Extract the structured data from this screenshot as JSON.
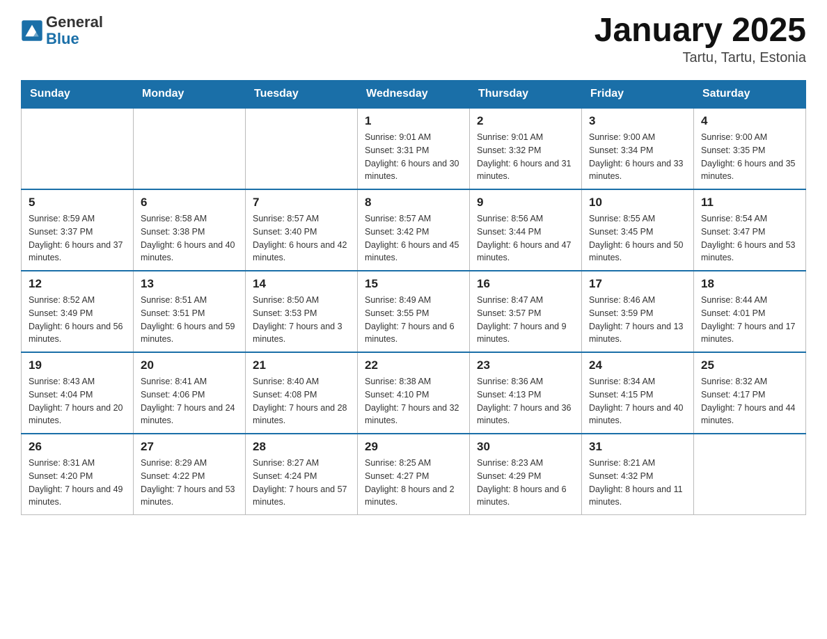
{
  "header": {
    "logo_general": "General",
    "logo_blue": "Blue",
    "month_title": "January 2025",
    "location": "Tartu, Tartu, Estonia"
  },
  "days_of_week": [
    "Sunday",
    "Monday",
    "Tuesday",
    "Wednesday",
    "Thursday",
    "Friday",
    "Saturday"
  ],
  "weeks": [
    [
      {
        "day": "",
        "info": ""
      },
      {
        "day": "",
        "info": ""
      },
      {
        "day": "",
        "info": ""
      },
      {
        "day": "1",
        "info": "Sunrise: 9:01 AM\nSunset: 3:31 PM\nDaylight: 6 hours\nand 30 minutes."
      },
      {
        "day": "2",
        "info": "Sunrise: 9:01 AM\nSunset: 3:32 PM\nDaylight: 6 hours\nand 31 minutes."
      },
      {
        "day": "3",
        "info": "Sunrise: 9:00 AM\nSunset: 3:34 PM\nDaylight: 6 hours\nand 33 minutes."
      },
      {
        "day": "4",
        "info": "Sunrise: 9:00 AM\nSunset: 3:35 PM\nDaylight: 6 hours\nand 35 minutes."
      }
    ],
    [
      {
        "day": "5",
        "info": "Sunrise: 8:59 AM\nSunset: 3:37 PM\nDaylight: 6 hours\nand 37 minutes."
      },
      {
        "day": "6",
        "info": "Sunrise: 8:58 AM\nSunset: 3:38 PM\nDaylight: 6 hours\nand 40 minutes."
      },
      {
        "day": "7",
        "info": "Sunrise: 8:57 AM\nSunset: 3:40 PM\nDaylight: 6 hours\nand 42 minutes."
      },
      {
        "day": "8",
        "info": "Sunrise: 8:57 AM\nSunset: 3:42 PM\nDaylight: 6 hours\nand 45 minutes."
      },
      {
        "day": "9",
        "info": "Sunrise: 8:56 AM\nSunset: 3:44 PM\nDaylight: 6 hours\nand 47 minutes."
      },
      {
        "day": "10",
        "info": "Sunrise: 8:55 AM\nSunset: 3:45 PM\nDaylight: 6 hours\nand 50 minutes."
      },
      {
        "day": "11",
        "info": "Sunrise: 8:54 AM\nSunset: 3:47 PM\nDaylight: 6 hours\nand 53 minutes."
      }
    ],
    [
      {
        "day": "12",
        "info": "Sunrise: 8:52 AM\nSunset: 3:49 PM\nDaylight: 6 hours\nand 56 minutes."
      },
      {
        "day": "13",
        "info": "Sunrise: 8:51 AM\nSunset: 3:51 PM\nDaylight: 6 hours\nand 59 minutes."
      },
      {
        "day": "14",
        "info": "Sunrise: 8:50 AM\nSunset: 3:53 PM\nDaylight: 7 hours\nand 3 minutes."
      },
      {
        "day": "15",
        "info": "Sunrise: 8:49 AM\nSunset: 3:55 PM\nDaylight: 7 hours\nand 6 minutes."
      },
      {
        "day": "16",
        "info": "Sunrise: 8:47 AM\nSunset: 3:57 PM\nDaylight: 7 hours\nand 9 minutes."
      },
      {
        "day": "17",
        "info": "Sunrise: 8:46 AM\nSunset: 3:59 PM\nDaylight: 7 hours\nand 13 minutes."
      },
      {
        "day": "18",
        "info": "Sunrise: 8:44 AM\nSunset: 4:01 PM\nDaylight: 7 hours\nand 17 minutes."
      }
    ],
    [
      {
        "day": "19",
        "info": "Sunrise: 8:43 AM\nSunset: 4:04 PM\nDaylight: 7 hours\nand 20 minutes."
      },
      {
        "day": "20",
        "info": "Sunrise: 8:41 AM\nSunset: 4:06 PM\nDaylight: 7 hours\nand 24 minutes."
      },
      {
        "day": "21",
        "info": "Sunrise: 8:40 AM\nSunset: 4:08 PM\nDaylight: 7 hours\nand 28 minutes."
      },
      {
        "day": "22",
        "info": "Sunrise: 8:38 AM\nSunset: 4:10 PM\nDaylight: 7 hours\nand 32 minutes."
      },
      {
        "day": "23",
        "info": "Sunrise: 8:36 AM\nSunset: 4:13 PM\nDaylight: 7 hours\nand 36 minutes."
      },
      {
        "day": "24",
        "info": "Sunrise: 8:34 AM\nSunset: 4:15 PM\nDaylight: 7 hours\nand 40 minutes."
      },
      {
        "day": "25",
        "info": "Sunrise: 8:32 AM\nSunset: 4:17 PM\nDaylight: 7 hours\nand 44 minutes."
      }
    ],
    [
      {
        "day": "26",
        "info": "Sunrise: 8:31 AM\nSunset: 4:20 PM\nDaylight: 7 hours\nand 49 minutes."
      },
      {
        "day": "27",
        "info": "Sunrise: 8:29 AM\nSunset: 4:22 PM\nDaylight: 7 hours\nand 53 minutes."
      },
      {
        "day": "28",
        "info": "Sunrise: 8:27 AM\nSunset: 4:24 PM\nDaylight: 7 hours\nand 57 minutes."
      },
      {
        "day": "29",
        "info": "Sunrise: 8:25 AM\nSunset: 4:27 PM\nDaylight: 8 hours\nand 2 minutes."
      },
      {
        "day": "30",
        "info": "Sunrise: 8:23 AM\nSunset: 4:29 PM\nDaylight: 8 hours\nand 6 minutes."
      },
      {
        "day": "31",
        "info": "Sunrise: 8:21 AM\nSunset: 4:32 PM\nDaylight: 8 hours\nand 11 minutes."
      },
      {
        "day": "",
        "info": ""
      }
    ]
  ]
}
